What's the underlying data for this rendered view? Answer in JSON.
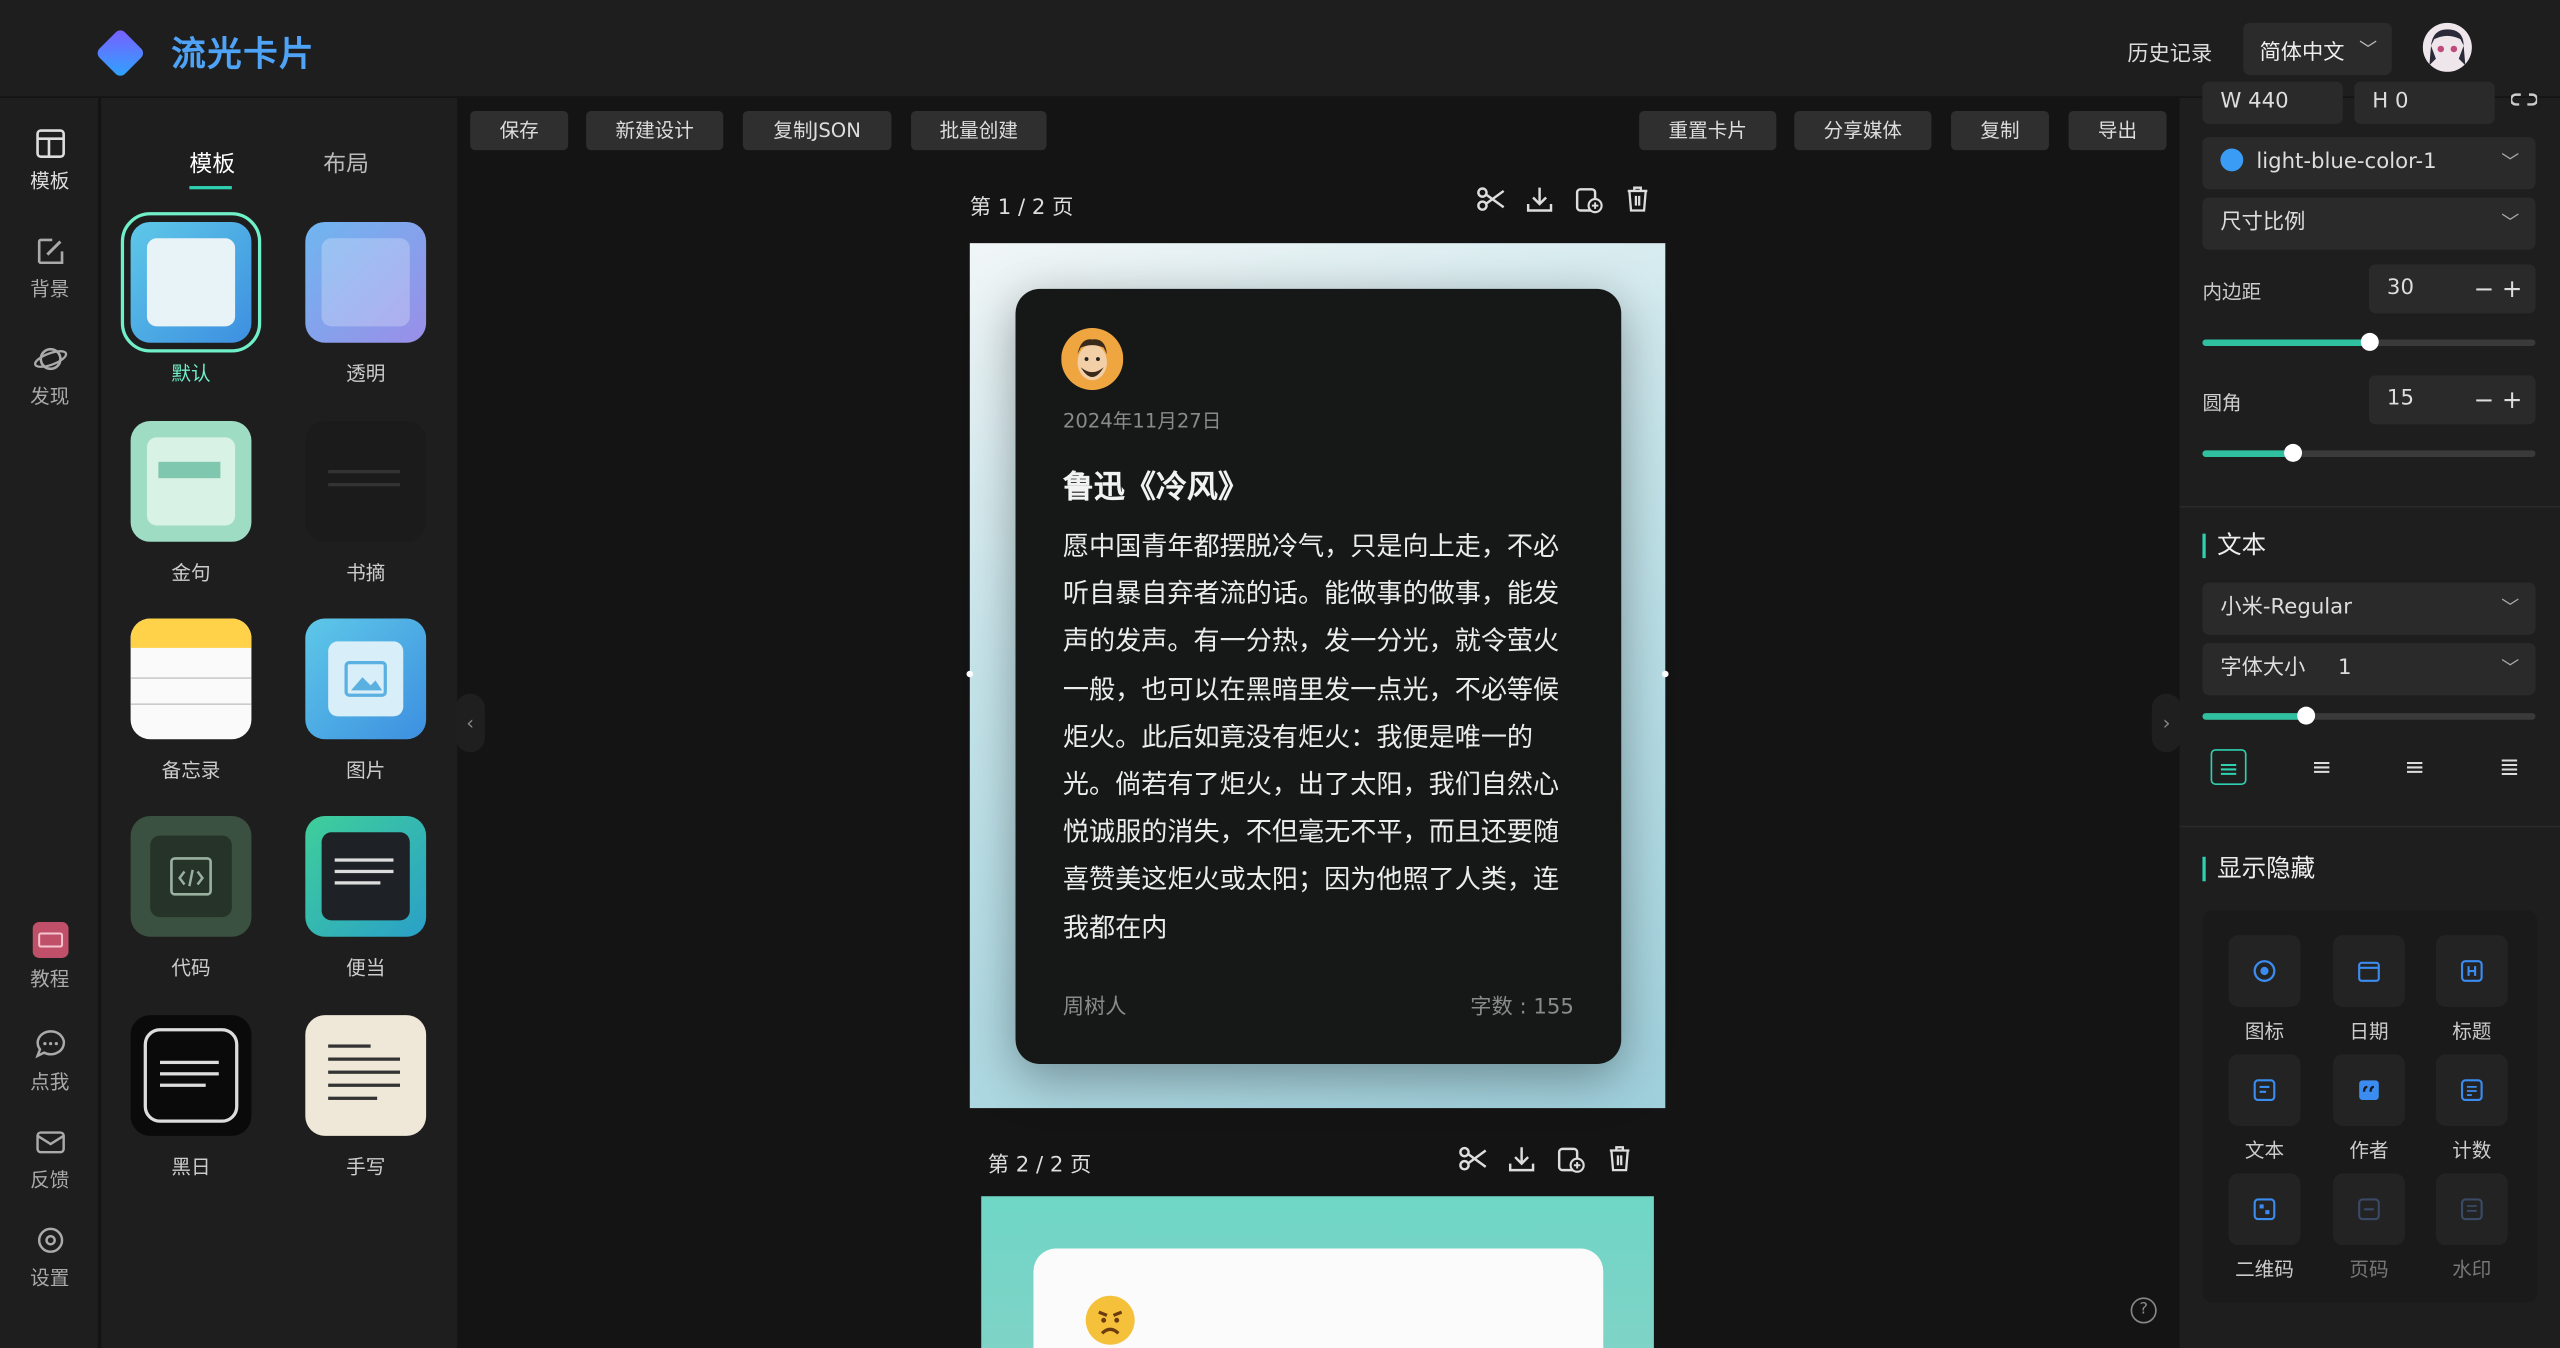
{
  "app": {
    "name": "流光卡片"
  },
  "header": {
    "history": "历史记录",
    "language": "简体中文"
  },
  "left_nav": [
    {
      "label": "模板",
      "icon": "template-icon"
    },
    {
      "label": "背景",
      "icon": "background-icon"
    },
    {
      "label": "发现",
      "icon": "discover-icon"
    },
    {
      "label": "教程",
      "icon": "tutorial-icon"
    },
    {
      "label": "点我",
      "icon": "chat-icon"
    },
    {
      "label": "反馈",
      "icon": "mail-icon"
    },
    {
      "label": "设置",
      "icon": "settings-icon"
    }
  ],
  "panel_tabs": [
    "模板",
    "布局"
  ],
  "templates": [
    "默认",
    "透明",
    "金句",
    "书摘",
    "备忘录",
    "图片",
    "代码",
    "便当",
    "黑日",
    "手写"
  ],
  "toolbar_left": [
    "保存",
    "新建设计",
    "复制JSON",
    "批量创建"
  ],
  "toolbar_right": [
    "重置卡片",
    "分享媒体",
    "复制",
    "导出"
  ],
  "pages": [
    {
      "label": "第 1 / 2 页"
    },
    {
      "label": "第 2 / 2 页"
    }
  ],
  "card": {
    "date": "2024年11月27日",
    "title": "鲁迅《冷风》",
    "body": "愿中国青年都摆脱冷气，只是向上走，不必听自暴自弃者流的话。能做事的做事，能发声的发声。有一分热，发一分光，就令萤火一般，也可以在黑暗里发一点光，不必等候炬火。此后如竟没有炬火：我便是唯一的光。倘若有了炬火，出了太阳，我们自然心悦诚服的消失，不但毫无不平，而且还要随喜赞美这炬火或太阳；因为他照了人类，连我都在内",
    "author": "周树人",
    "count": "字数 : 155"
  },
  "right": {
    "width": "W 440",
    "height": "H 0",
    "color": "light-blue-color-1",
    "ratio": "尺寸比例",
    "padding_label": "内边距",
    "padding": "30",
    "padding_level": 0.5,
    "radius_label": "圆角",
    "radius": "15",
    "radius_level": 0.27,
    "text_section": "文本",
    "font": "小米-Regular",
    "fontsize_label": "字体大小",
    "fontsize": "1",
    "fontsize_level": 0.31,
    "visibility_section": "显示隐藏",
    "visibility": [
      {
        "label": "图标",
        "on": true
      },
      {
        "label": "日期",
        "on": true
      },
      {
        "label": "标题",
        "on": true
      },
      {
        "label": "文本",
        "on": true
      },
      {
        "label": "作者",
        "on": true
      },
      {
        "label": "计数",
        "on": true
      },
      {
        "label": "二维码",
        "on": true
      },
      {
        "label": "页码",
        "on": false
      },
      {
        "label": "水印",
        "on": false
      }
    ]
  },
  "colors": {
    "accent": "#2fd0b0",
    "brand": "#4fa3f7",
    "selected": "#6ff0c8"
  }
}
